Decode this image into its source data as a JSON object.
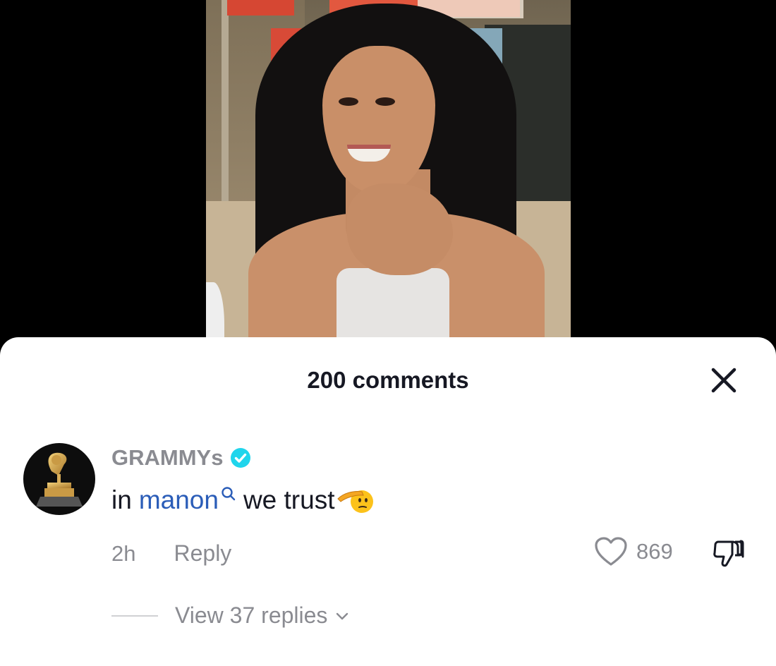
{
  "video": {
    "description_icon": "video-frame"
  },
  "comments_panel": {
    "title": "200 comments",
    "close_icon": "close-icon"
  },
  "comment": {
    "username": "GRAMMYs",
    "verified": true,
    "text_before": "in",
    "mention": "manon",
    "text_after": "we trust",
    "emoji": "saluting-face-emoji",
    "time": "2h",
    "reply_label": "Reply",
    "like_count": "869",
    "view_replies_label": "View 37 replies"
  },
  "colors": {
    "mention": "#2b5db8",
    "verified": "#20d5ec",
    "muted_text": "#8a8b91",
    "primary_text": "#161823"
  }
}
